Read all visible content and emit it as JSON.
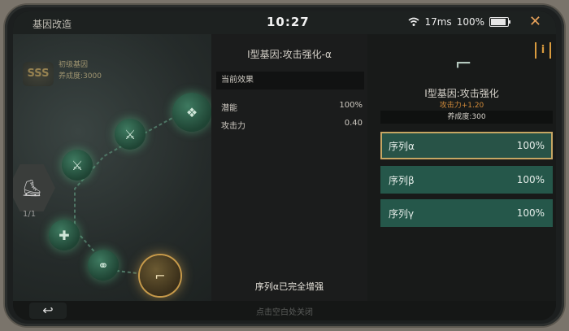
{
  "status": {
    "title": "基因改造",
    "time": "10:27",
    "ping": "17ms",
    "battery": "100%",
    "close_icon": "close-icon"
  },
  "map": {
    "badge": "SSS",
    "gene_level": "初级基因",
    "cultivation": "养成度:3000",
    "slot_count": "1/1"
  },
  "middle": {
    "title": "I型基因:攻击强化-α",
    "section_label": "当前效果",
    "stats": [
      {
        "label": "潜能",
        "value": "100%"
      },
      {
        "label": "攻击力",
        "value": "0.40"
      }
    ],
    "footer": "序列α已完全增强"
  },
  "right": {
    "info": "i",
    "gene_name": "I型基因:攻击强化",
    "bonus": "攻击力+1.20",
    "cultivation": "养成度:300",
    "sequences": [
      {
        "label": "序列α",
        "value": "100%",
        "selected": true
      },
      {
        "label": "序列β",
        "value": "100%",
        "selected": false
      },
      {
        "label": "序列γ",
        "value": "100%",
        "selected": false
      }
    ]
  },
  "bottom": {
    "hint": "点击空白处关闭",
    "back_icon": "back-arrow-icon"
  },
  "colors": {
    "accent_orange": "#d99b3e",
    "sequence_green": "#25574a",
    "selected_border": "#c6a663"
  }
}
